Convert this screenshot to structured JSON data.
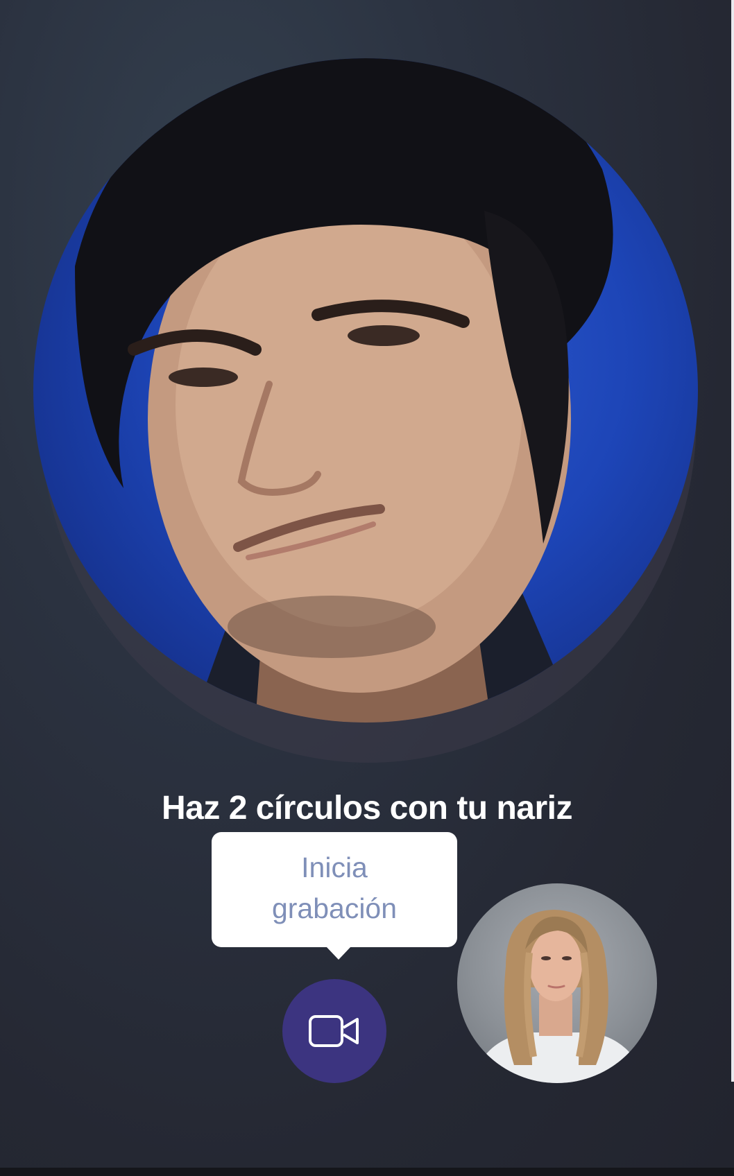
{
  "instruction": "Haz 2 círculos con tu nariz",
  "tooltip": {
    "line1": "Inicia",
    "line2": "grabación"
  },
  "record_button": {
    "icon": "video-camera-icon"
  },
  "colors": {
    "background": "#23252f",
    "record_button": "#3c3480",
    "tooltip_text": "#7f8fb8",
    "camera_backdrop": "#1d45b7"
  }
}
